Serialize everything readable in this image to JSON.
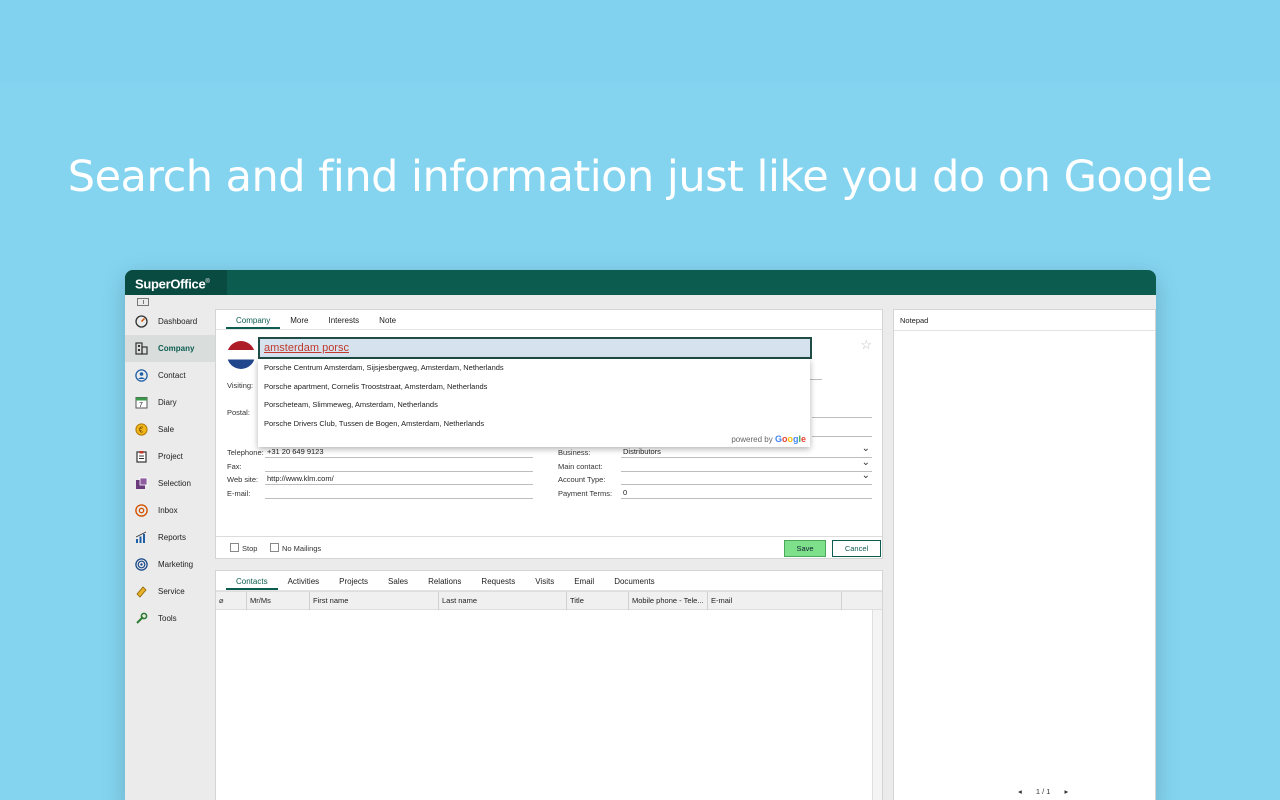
{
  "headline": "Search and find information just like you do on Google",
  "app": {
    "logo": "SuperOffice",
    "logo_mark": "®"
  },
  "sidebar": {
    "items": [
      {
        "label": "Dashboard",
        "icon": "gauge-icon"
      },
      {
        "label": "Company",
        "icon": "building-icon",
        "active": true
      },
      {
        "label": "Contact",
        "icon": "person-icon"
      },
      {
        "label": "Diary",
        "icon": "calendar-icon"
      },
      {
        "label": "Sale",
        "icon": "coin-icon"
      },
      {
        "label": "Project",
        "icon": "clipboard-icon"
      },
      {
        "label": "Selection",
        "icon": "selection-icon"
      },
      {
        "label": "Inbox",
        "icon": "at-icon"
      },
      {
        "label": "Reports",
        "icon": "bar-chart-icon"
      },
      {
        "label": "Marketing",
        "icon": "target-icon"
      },
      {
        "label": "Service",
        "icon": "ticket-icon"
      },
      {
        "label": "Tools",
        "icon": "wrench-icon"
      }
    ],
    "calendar_day": "7"
  },
  "company_tabs": [
    "Company",
    "More",
    "Interests",
    "Note"
  ],
  "search": {
    "value": "amsterdam porsc",
    "suggestions": [
      "Porsche Centrum Amsterdam, Sijsjesbergweg, Amsterdam, Netherlands",
      "Porsche apartment, Cornelis Trooststraat, Amsterdam, Netherlands",
      "Porscheteam, Slimmeweg, Amsterdam, Netherlands",
      "Porsche Drivers Club, Tussen de Bogen, Amsterdam, Netherlands"
    ],
    "powered_by": "powered by"
  },
  "form": {
    "visiting_label": "Visiting:",
    "postal_label": "Postal:",
    "telephone_label": "Telephone:",
    "telephone_value": "+31 20 649 9123",
    "fax_label": "Fax:",
    "website_label": "Web site:",
    "website_value": "http://www.klm.com/",
    "email_label": "E-mail:",
    "business_label": "Business:",
    "business_value": "Distributors",
    "main_contact_label": "Main contact:",
    "account_type_label": "Account Type:",
    "payment_terms_label": "Payment Terms:",
    "payment_terms_value": "0"
  },
  "actions": {
    "stop_label": "Stop",
    "no_mailings_label": "No Mailings",
    "save_label": "Save",
    "cancel_label": "Cancel"
  },
  "bottom_tabs": [
    "Contacts",
    "Activities",
    "Projects",
    "Sales",
    "Relations",
    "Requests",
    "Visits",
    "Email",
    "Documents"
  ],
  "grid_columns": [
    "Mr/Ms",
    "First name",
    "Last name",
    "Title",
    "Mobile phone - Tele...",
    "E-mail"
  ],
  "notepad": {
    "title": "Notepad",
    "pager": "1 / 1"
  }
}
